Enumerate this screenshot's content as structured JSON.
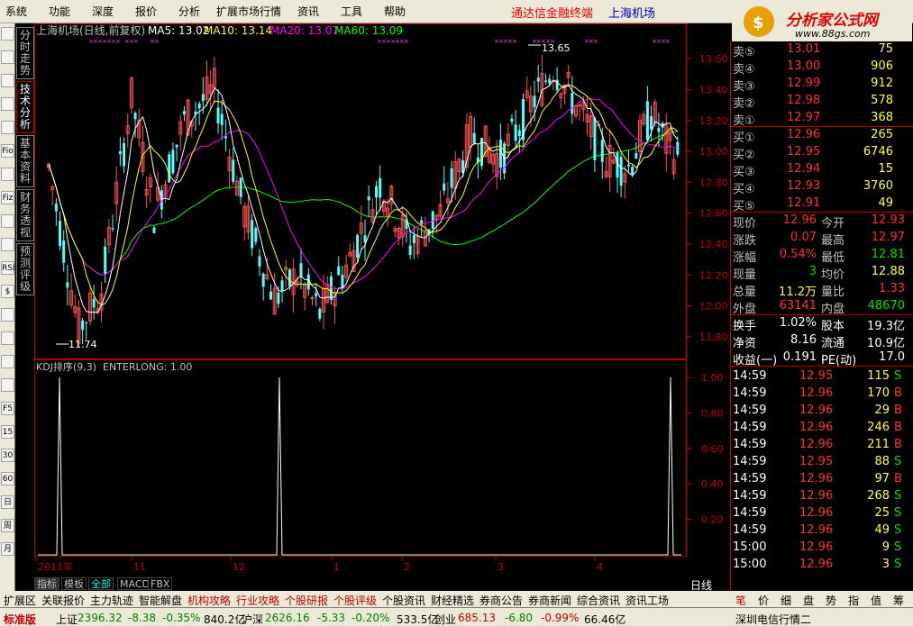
{
  "menu": [
    "系统",
    "功能",
    "深度",
    "报价",
    "分析",
    "扩展市场行情",
    "资讯",
    "工具",
    "帮助"
  ],
  "brand_title": "通达信金融终端",
  "stock_title": "上海机场",
  "logo": {
    "text": "分析家公式网",
    "url": "www.88gs.com"
  },
  "left_tabs": [
    "分时走势",
    "技术分析",
    "基本资料",
    "财务透视",
    "预测评级"
  ],
  "left_tools": [
    "",
    "",
    "",
    "",
    "",
    "Fio",
    "",
    "Fiz",
    "",
    "",
    "RSI",
    "$",
    "",
    "",
    "",
    "",
    "F5",
    "15",
    "30",
    "60",
    "日",
    "周",
    "月"
  ],
  "main_chart": {
    "header": "上海机场(日线,前复权)",
    "ma5": "MA5: 13.02",
    "ma10": "MA10: 13.14",
    "ma20": "MA20: 13.07",
    "ma60": "MA60: 13.09",
    "high_label": "13.65",
    "low_label": "11.74",
    "y_ticks": [
      "13.60",
      "13.40",
      "13.20",
      "13.00",
      "12.80",
      "12.60",
      "12.40",
      "12.20",
      "12.00",
      "11.80"
    ],
    "colors": {
      "ma5": "#ffffff",
      "ma10": "#ffff00",
      "ma20": "#ff00ff",
      "ma60": "#00ff00",
      "up": "#ff5050",
      "down": "#54ffff"
    }
  },
  "chart_data": {
    "type": "candlestick",
    "title": "上海机场(日线,前复权)",
    "ylim": [
      11.7,
      13.7
    ],
    "x_month_labels": [
      "2011年",
      "11",
      "12",
      "1",
      "2",
      "3",
      "4"
    ],
    "price_high": 13.65,
    "price_low": 11.74,
    "ma_latest": {
      "MA5": 13.02,
      "MA10": 13.14,
      "MA20": 13.07,
      "MA60": 13.09
    }
  },
  "kdj": {
    "header": "KDJ排序(9,3)",
    "enterlong": "ENTERLONG: 1.00",
    "y_ticks": [
      "1.00",
      "0.80",
      "0.60",
      "0.40",
      "0.20"
    ]
  },
  "x_axis": [
    "2011年",
    "11",
    "12",
    "1",
    "2",
    "3",
    "4"
  ],
  "chart_tabs": [
    "指标",
    "模板",
    "全部",
    "MACD",
    "FBX"
  ],
  "period": "日线",
  "order_book": {
    "asks": [
      {
        "label": "卖⑤",
        "price": "13.01",
        "vol": "75"
      },
      {
        "label": "卖④",
        "price": "13.00",
        "vol": "906"
      },
      {
        "label": "卖③",
        "price": "12.99",
        "vol": "912"
      },
      {
        "label": "卖②",
        "price": "12.98",
        "vol": "578"
      },
      {
        "label": "卖①",
        "price": "12.97",
        "vol": "368"
      }
    ],
    "bids": [
      {
        "label": "买①",
        "price": "12.96",
        "vol": "265"
      },
      {
        "label": "买②",
        "price": "12.95",
        "vol": "6746"
      },
      {
        "label": "买③",
        "price": "12.94",
        "vol": "15"
      },
      {
        "label": "买④",
        "price": "12.93",
        "vol": "3760"
      },
      {
        "label": "买⑤",
        "price": "12.91",
        "vol": "49"
      }
    ]
  },
  "quote": [
    {
      "l1": "现价",
      "v1": "12.96",
      "c1": "red",
      "l2": "今开",
      "v2": "12.93",
      "c2": "red"
    },
    {
      "l1": "涨跌",
      "v1": "0.07",
      "c1": "red",
      "l2": "最高",
      "v2": "12.97",
      "c2": "red"
    },
    {
      "l1": "涨幅",
      "v1": "0.54%",
      "c1": "red",
      "l2": "最低",
      "v2": "12.81",
      "c2": "grn"
    },
    {
      "l1": "现量",
      "v1": "3",
      "c1": "grn",
      "l2": "均价",
      "v2": "12.88",
      "c2": "yel"
    },
    {
      "l1": "总量",
      "v1": "11.2万",
      "c1": "yel",
      "l2": "量比",
      "v2": "1.33",
      "c2": "red"
    },
    {
      "l1": "外盘",
      "v1": "63141",
      "c1": "red",
      "l2": "内盘",
      "v2": "48670",
      "c2": "grn"
    }
  ],
  "fund": [
    {
      "l1": "换手",
      "v1": "1.02%",
      "l2": "股本",
      "v2": "19.3亿"
    },
    {
      "l1": "净资",
      "v1": "8.16",
      "l2": "流通",
      "v2": "10.9亿"
    },
    {
      "l1": "收益(一)",
      "v1": "0.191",
      "l2": "PE(动)",
      "v2": "17.0"
    }
  ],
  "ticks": [
    {
      "t": "14:59",
      "p": "12.95",
      "v": "115",
      "s": "S"
    },
    {
      "t": "14:59",
      "p": "12.96",
      "v": "170",
      "s": "B"
    },
    {
      "t": "14:59",
      "p": "12.96",
      "v": "29",
      "s": "B"
    },
    {
      "t": "14:59",
      "p": "12.96",
      "v": "246",
      "s": "B"
    },
    {
      "t": "14:59",
      "p": "12.96",
      "v": "211",
      "s": "B"
    },
    {
      "t": "14:59",
      "p": "12.95",
      "v": "88",
      "s": "S"
    },
    {
      "t": "14:59",
      "p": "12.96",
      "v": "97",
      "s": "B"
    },
    {
      "t": "14:59",
      "p": "12.96",
      "v": "268",
      "s": "S"
    },
    {
      "t": "14:59",
      "p": "12.96",
      "v": "25",
      "s": "S"
    },
    {
      "t": "14:59",
      "p": "12.96",
      "v": "49",
      "s": "S"
    },
    {
      "t": "15:00",
      "p": "12.96",
      "v": "9",
      "s": "S"
    },
    {
      "t": "15:00",
      "p": "12.96",
      "v": "3",
      "s": "S"
    }
  ],
  "right_tabs": [
    "笔",
    "价",
    "细",
    "盘",
    "势",
    "指",
    "值",
    "筹"
  ],
  "func_bar": [
    "扩展区",
    "关联报价",
    "主力轨迹",
    "智能解盘",
    "机构攻略",
    "行业攻略",
    "个股研报",
    "个股评级",
    "个股资讯",
    "财经精选",
    "券商公告",
    "券商新闻",
    "综合资讯",
    "资讯工场"
  ],
  "status": {
    "sh_label": "上证",
    "sh_val": "2396.32",
    "sh_chg": "-8.38",
    "sh_pct": "-0.35%",
    "sh_amt": "840.2亿",
    "sz_label": "沪深",
    "sz_val": "2626.16",
    "sz_chg": "-5.33",
    "sz_pct": "-0.20%",
    "sz_amt": "533.5亿",
    "cy_label": "创业",
    "cy_val": "685.13",
    "cy_chg": "-6.80",
    "cy_pct": "-0.99%",
    "cy_amt": "66.46亿",
    "right": "深圳电信行情二"
  }
}
